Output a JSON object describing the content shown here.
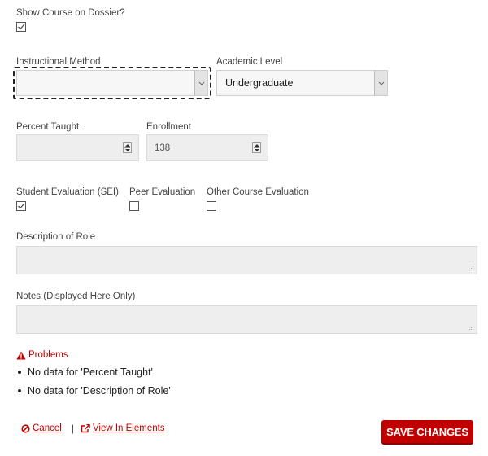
{
  "show_on_dossier": {
    "label": "Show Course on Dossier?",
    "checked": true
  },
  "instructional_method": {
    "label": "Instructional Method",
    "value": ""
  },
  "academic_level": {
    "label": "Academic Level",
    "value": "Undergraduate"
  },
  "percent_taught": {
    "label": "Percent Taught",
    "value": ""
  },
  "enrollment": {
    "label": "Enrollment",
    "value": "138"
  },
  "evaluations": [
    {
      "label": "Student Evaluation (SEI)",
      "checked": true
    },
    {
      "label": "Peer Evaluation",
      "checked": false
    },
    {
      "label": "Other Course Evaluation",
      "checked": false
    }
  ],
  "description_of_role": {
    "label": "Description of Role",
    "value": ""
  },
  "notes": {
    "label": "Notes (Displayed Here Only)",
    "value": ""
  },
  "problems": {
    "title": "Problems",
    "icon": "warning-triangle-icon",
    "items": [
      "No data for 'Percent Taught'",
      "No data for 'Description of Role'"
    ]
  },
  "footer": {
    "cancel_label": "Cancel",
    "separator": "|",
    "view_label": "View In Elements",
    "save_label": "SAVE CHANGES"
  },
  "colors": {
    "accent": "#c00000",
    "field_bg": "#eeeeee"
  }
}
